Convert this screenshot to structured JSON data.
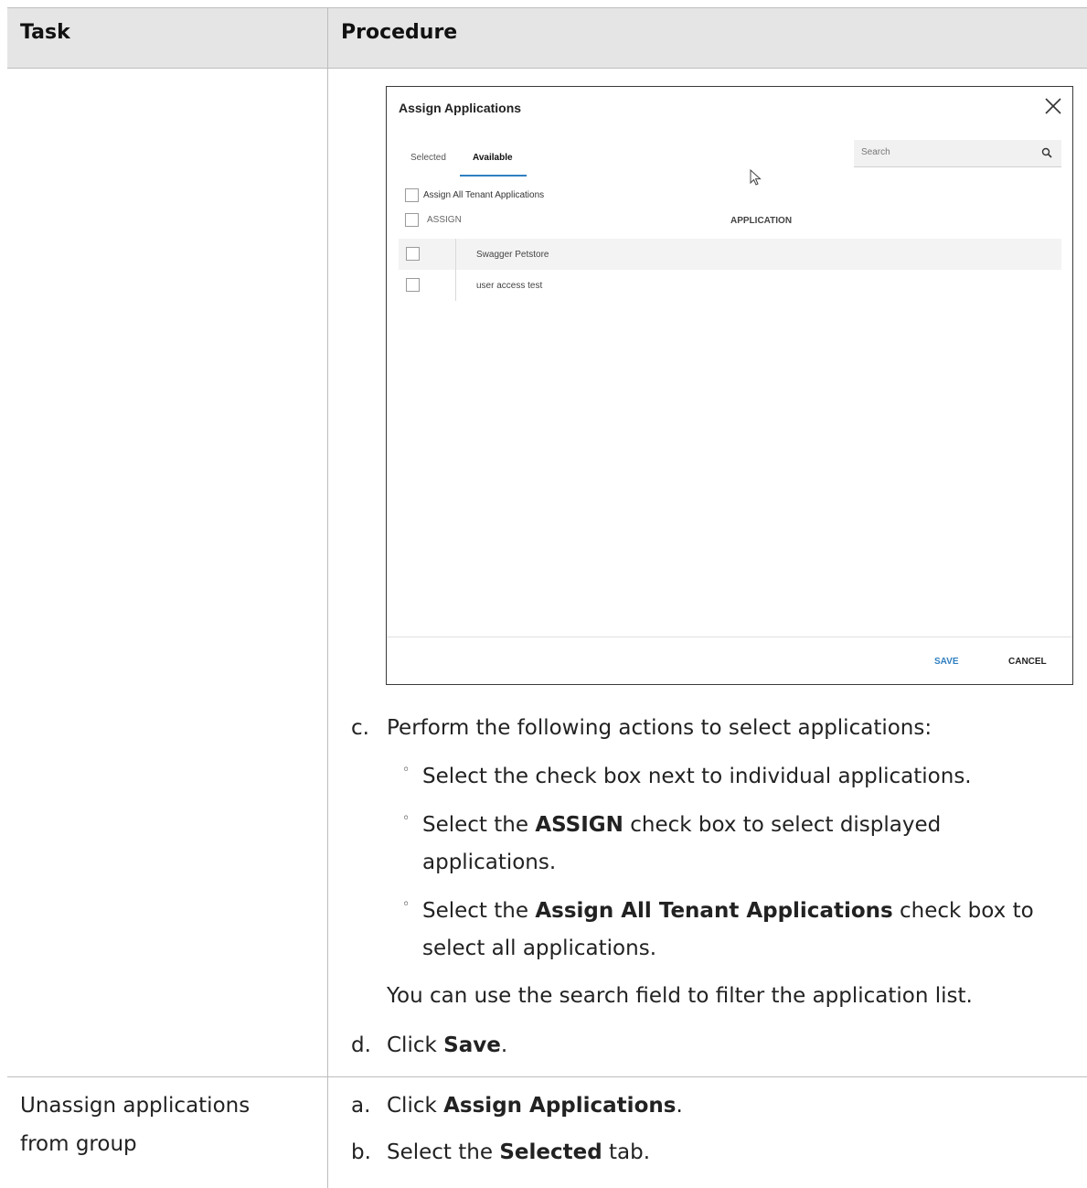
{
  "table": {
    "headers": {
      "task": "Task",
      "procedure": "Procedure"
    }
  },
  "dialog": {
    "title": "Assign Applications",
    "tabs": [
      "Selected",
      "Available"
    ],
    "active_tab": "Available",
    "search_placeholder": "Search",
    "assign_all_label": "Assign All Tenant Applications",
    "assign_header": "ASSIGN",
    "application_header": "APPLICATION",
    "applications": [
      "Swagger Petstore",
      "user access test"
    ],
    "save_label": "SAVE",
    "cancel_label": "CANCEL"
  },
  "steps": {
    "c": {
      "marker": "c.",
      "text": "Perform the following actions to select applications:",
      "bullets": [
        {
          "pre": "Select the check box next to individual applications.",
          "bold": "",
          "post": ""
        },
        {
          "pre": "Select the ",
          "bold": "ASSIGN",
          "post": " check box to select displayed",
          "line2": "applications."
        },
        {
          "pre": "Select the ",
          "bold": "Assign All Tenant Applications",
          "post": " check box to",
          "line2": "select all applications."
        }
      ],
      "note": "You can use the search field to filter the application list."
    },
    "d": {
      "marker": "d.",
      "pre": "Click ",
      "bold": "Save",
      "post": "."
    }
  },
  "row2": {
    "task_line1": "Unassign applications",
    "task_line2": "from group",
    "a": {
      "marker": "a.",
      "pre": "Click ",
      "bold": "Assign Applications",
      "post": "."
    },
    "b": {
      "marker": "b.",
      "pre": "Select the ",
      "bold": "Selected",
      "post": " tab."
    }
  }
}
